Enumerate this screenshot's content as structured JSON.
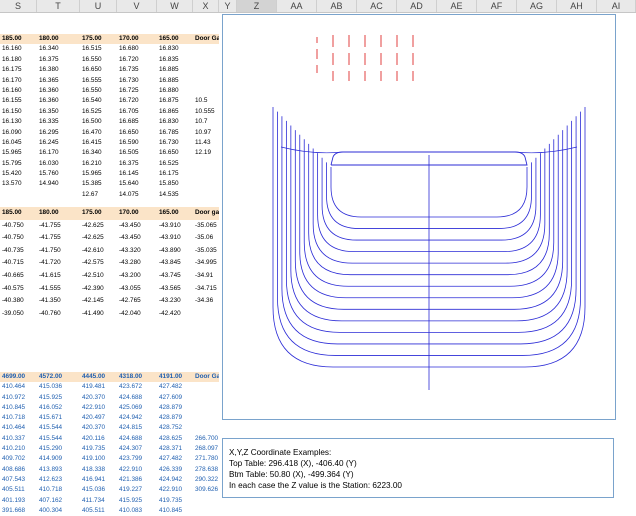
{
  "columns": [
    "S",
    "T",
    "U",
    "V",
    "W",
    "X",
    "Y",
    "Z",
    "AA",
    "AB",
    "AC",
    "AD",
    "AE",
    "AF",
    "AG",
    "AH",
    "AI"
  ],
  "table1": {
    "header": [
      "185.00",
      "180.00",
      "175.00",
      "170.00",
      "165.00",
      "Door Gap"
    ],
    "rows": [
      [
        "16.160",
        "16.340",
        "16.515",
        "16.680",
        "16.830",
        ""
      ],
      [
        "16.180",
        "16.375",
        "16.550",
        "16.720",
        "16.835",
        ""
      ],
      [
        "16.175",
        "16.380",
        "16.650",
        "16.735",
        "16.885",
        ""
      ],
      [
        "16.170",
        "16.365",
        "16.555",
        "16.730",
        "16.885",
        ""
      ],
      [
        "16.160",
        "16.360",
        "16.550",
        "16.725",
        "16.880",
        ""
      ],
      [
        "16.155",
        "16.360",
        "16.540",
        "16.720",
        "16.875",
        "10.5"
      ],
      [
        "16.150",
        "16.350",
        "16.525",
        "16.705",
        "16.865",
        "10.555"
      ],
      [
        "16.130",
        "16.335",
        "16.500",
        "16.685",
        "16.830",
        "10.7"
      ],
      [
        "16.090",
        "16.295",
        "16.470",
        "16.650",
        "16.785",
        "10.97"
      ],
      [
        "16.045",
        "16.245",
        "16.415",
        "16.590",
        "16.730",
        "11.43"
      ],
      [
        "15.965",
        "16.170",
        "16.340",
        "16.505",
        "16.650",
        "12.19"
      ],
      [
        "15.795",
        "16.030",
        "16.210",
        "16.375",
        "16.525",
        ""
      ],
      [
        "15.420",
        "15.760",
        "15.965",
        "16.145",
        "16.175",
        ""
      ],
      [
        "13.570",
        "14.940",
        "15.385",
        "15.640",
        "15.850",
        ""
      ],
      [
        "",
        "",
        "12.67",
        "14.075",
        "14.535",
        ""
      ]
    ]
  },
  "table2": {
    "header": [
      "185.00",
      "180.00",
      "175.00",
      "170.00",
      "165.00",
      "Door gap"
    ],
    "rows": [
      [
        "-40.750",
        "-41.755",
        "-42.625",
        "-43.450",
        "-43.910",
        "-35.065"
      ],
      [
        "-40.750",
        "-41.755",
        "-42.625",
        "-43.450",
        "-43.910",
        "-35.06"
      ],
      [
        "-40.735",
        "-41.750",
        "-42.610",
        "-43.320",
        "-43.890",
        "-35.035"
      ],
      [
        "-40.715",
        "-41.720",
        "-42.575",
        "-43.280",
        "-43.845",
        "-34.995"
      ],
      [
        "-40.665",
        "-41.615",
        "-42.510",
        "-43.200",
        "-43.745",
        "-34.91"
      ],
      [
        "-40.575",
        "-41.555",
        "-42.390",
        "-43.055",
        "-43.565",
        "-34.715"
      ],
      [
        "-40.380",
        "-41.350",
        "-42.145",
        "-42.765",
        "-43.230",
        "-34.36"
      ],
      [
        "-39.050",
        "-40.760",
        "-41.490",
        "-42.040",
        "-42.420",
        ""
      ]
    ]
  },
  "table3": {
    "header": [
      "4699.00",
      "4572.00",
      "4445.00",
      "4318.00",
      "4191.00",
      "Door Gap"
    ],
    "rows": [
      [
        "410.464",
        "415.036",
        "419.481",
        "423.672",
        "427.482",
        ""
      ],
      [
        "410.972",
        "415.925",
        "420.370",
        "424.688",
        "427.609",
        ""
      ],
      [
        "410.845",
        "416.052",
        "422.910",
        "425.069",
        "428.879",
        ""
      ],
      [
        "410.718",
        "415.671",
        "420.497",
        "424.942",
        "428.879",
        ""
      ],
      [
        "410.464",
        "415.544",
        "420.370",
        "424.815",
        "428.752",
        ""
      ],
      [
        "410.337",
        "415.544",
        "420.116",
        "424.688",
        "428.625",
        "266.700"
      ],
      [
        "410.210",
        "415.290",
        "419.735",
        "424.307",
        "428.371",
        "268.097"
      ],
      [
        "409.702",
        "414.909",
        "419.100",
        "423.799",
        "427.482",
        "271.780"
      ],
      [
        "408.686",
        "413.893",
        "418.338",
        "422.910",
        "426.339",
        "278.638"
      ],
      [
        "407.543",
        "412.623",
        "416.941",
        "421.386",
        "424.942",
        "290.322"
      ],
      [
        "405.511",
        "410.718",
        "415.036",
        "419.227",
        "422.910",
        "309.626"
      ],
      [
        "401.193",
        "407.162",
        "411.734",
        "415.925",
        "419.735",
        ""
      ],
      [
        "391.668",
        "400.304",
        "405.511",
        "410.083",
        "410.845",
        ""
      ]
    ]
  },
  "note": {
    "line1": "X,Y,Z Coordinate Examples:",
    "line2": "Top Table: 296.418 (X), -406.40 (Y)",
    "line3": "Btm Table: 50.80 (X), -499.364 (Y)",
    "line4": "In each case the Z value is the Station: 6223.00"
  },
  "colors": {
    "header_fill": "#fbe4c8",
    "curve": "#2b2bd6",
    "mark": "#e04040",
    "border": "#7aa3cc",
    "blue_text": "#1f5fb0"
  }
}
